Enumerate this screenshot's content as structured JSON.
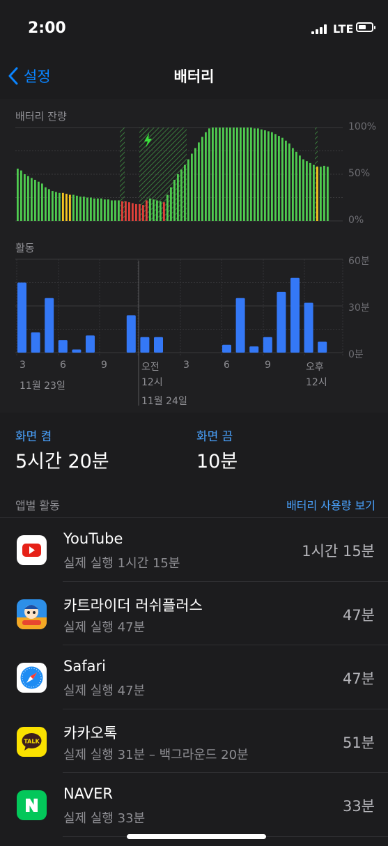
{
  "status": {
    "time": "2:00",
    "network": "LTE"
  },
  "nav": {
    "back_label": "설정",
    "title": "배터리"
  },
  "battery_chart": {
    "label": "배터리 잔량",
    "y_ticks": [
      "100%",
      "50%",
      "0%"
    ],
    "colors": {
      "green": "#4fcb50",
      "yellow": "#f5c521",
      "red": "#e0413a",
      "charging_icon": "#3ae13b"
    }
  },
  "activity_chart": {
    "label": "활동",
    "y_ticks": [
      "60분",
      "30분",
      "0분"
    ],
    "x_labels": [
      "3",
      "6",
      "9",
      "오전",
      "3",
      "6",
      "9",
      "오후"
    ],
    "x_labels_line2": [
      "12시",
      "12시"
    ],
    "date_labels": [
      "11월 23일",
      "11월 24일"
    ],
    "bar_color": "#3478f6"
  },
  "chart_data": [
    {
      "type": "bar",
      "title": "배터리 잔량",
      "ylim": [
        0,
        100
      ],
      "values": [
        56,
        54,
        50,
        48,
        46,
        44,
        42,
        40,
        36,
        34,
        32,
        31,
        30,
        30,
        29,
        28,
        28,
        27,
        26,
        26,
        25,
        25,
        24,
        24,
        24,
        23,
        23,
        22,
        22,
        22,
        21,
        21,
        20,
        19,
        18,
        18,
        17,
        22,
        24,
        23,
        22,
        21,
        20,
        28,
        36,
        44,
        50,
        55,
        60,
        66,
        72,
        78,
        84,
        90,
        95,
        99,
        100,
        100,
        100,
        100,
        100,
        100,
        100,
        100,
        100,
        100,
        100,
        100,
        99,
        99,
        98,
        97,
        96,
        95,
        93,
        91,
        89,
        86,
        83,
        78,
        74,
        70,
        66,
        64,
        62,
        60,
        58,
        58,
        59,
        58
      ]
    },
    {
      "type": "bar",
      "title": "활동",
      "ylim": [
        0,
        60
      ],
      "x": [
        "3",
        "4",
        "5",
        "6",
        "7",
        "8",
        "9",
        "10",
        "11",
        "오전 12시",
        "1",
        "2",
        "3",
        "4",
        "5",
        "6",
        "7",
        "8",
        "9",
        "10",
        "11",
        "오후 12시"
      ],
      "values": [
        45,
        13,
        35,
        8,
        2,
        11,
        0,
        0,
        24,
        10,
        10,
        0,
        0,
        0,
        0,
        5,
        35,
        4,
        10,
        39,
        48,
        32,
        7
      ]
    }
  ],
  "screen": {
    "on_label": "화면 켬",
    "on_value": "5시간 20분",
    "off_label": "화면 끔",
    "off_value": "10분"
  },
  "apps_header": {
    "title": "앱별 활동",
    "link": "배터리 사용량 보기"
  },
  "apps": [
    {
      "name": "YouTube",
      "detail": "실제 실행 1시간 15분",
      "usage": "1시간 15분",
      "icon": "youtube-icon"
    },
    {
      "name": "카트라이더 러쉬플러스",
      "detail": "실제 실행 47분",
      "usage": "47분",
      "icon": "kartrider-icon"
    },
    {
      "name": "Safari",
      "detail": "실제 실행 47분",
      "usage": "47분",
      "icon": "safari-icon"
    },
    {
      "name": "카카오톡",
      "detail": "실제 실행 31분 – 백그라운드 20분",
      "usage": "51분",
      "icon": "kakaotalk-icon"
    },
    {
      "name": "NAVER",
      "detail": "실제 실행 33분",
      "usage": "33분",
      "icon": "naver-icon"
    }
  ]
}
